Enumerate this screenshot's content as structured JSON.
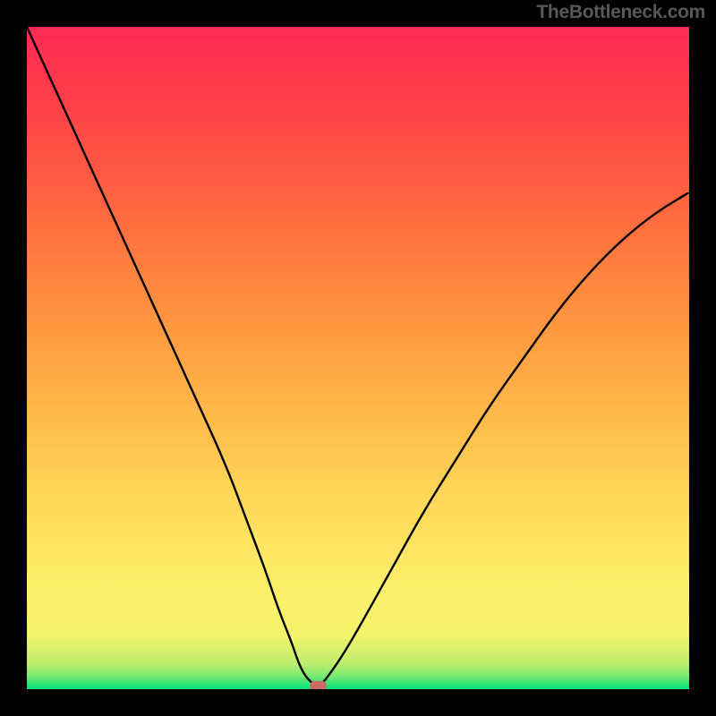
{
  "watermark": "TheBottleneck.com",
  "chart_data": {
    "type": "line",
    "title": "",
    "xlabel": "",
    "ylabel": "",
    "xlim": [
      0,
      100
    ],
    "ylim": [
      0,
      100
    ],
    "background_gradient": {
      "stops": [
        {
          "offset": 0.0,
          "color": "#00e277"
        },
        {
          "offset": 0.02,
          "color": "#7be973"
        },
        {
          "offset": 0.04,
          "color": "#c0ee6c"
        },
        {
          "offset": 0.08,
          "color": "#f3f36b"
        },
        {
          "offset": 0.15,
          "color": "#fdf06a"
        },
        {
          "offset": 0.3,
          "color": "#ffd557"
        },
        {
          "offset": 0.45,
          "color": "#ffb046"
        },
        {
          "offset": 0.6,
          "color": "#ff8a3e"
        },
        {
          "offset": 0.75,
          "color": "#ff6140"
        },
        {
          "offset": 0.9,
          "color": "#ff3c4a"
        },
        {
          "offset": 1.0,
          "color": "#ff2b52"
        }
      ]
    },
    "series": [
      {
        "name": "bottleneck-curve",
        "color": "#000000",
        "x": [
          0,
          5,
          10,
          15,
          20,
          25,
          30,
          33,
          36,
          38,
          40,
          41,
          42,
          43,
          44,
          47,
          50,
          55,
          60,
          65,
          70,
          75,
          80,
          85,
          90,
          95,
          100
        ],
        "y": [
          100,
          89,
          78,
          67,
          56,
          45,
          34,
          26,
          18,
          12,
          7,
          4,
          2,
          1,
          0,
          4,
          9,
          18,
          27,
          35,
          43,
          50,
          57,
          63,
          68,
          72,
          75
        ]
      }
    ],
    "marker": {
      "name": "optimum-marker",
      "shape": "rounded-rect",
      "cx": 44,
      "cy": 0.5,
      "width": 2.5,
      "height": 1.5,
      "color": "#c96a64"
    }
  }
}
